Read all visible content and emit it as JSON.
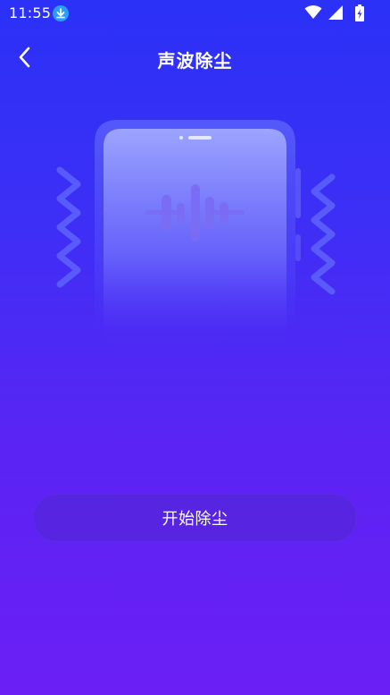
{
  "status_bar": {
    "time": "11:55",
    "icons": [
      "download-icon",
      "wifi-icon",
      "cellular-signal-icon",
      "battery-charging-icon"
    ]
  },
  "header": {
    "title": "声波除尘",
    "back_icon": "chevron-left-icon"
  },
  "illustration": {
    "icon_names": [
      "phone-icon",
      "sound-wave-icon",
      "vibration-zigzag-icon"
    ]
  },
  "actions": {
    "start_label": "开始除尘"
  },
  "colors": {
    "background_top": "#2b31f7",
    "background_bottom": "#6b1ff5",
    "button_fill": "#5028d2",
    "text": "#ffffff",
    "download_badge": "#2d9cff"
  }
}
